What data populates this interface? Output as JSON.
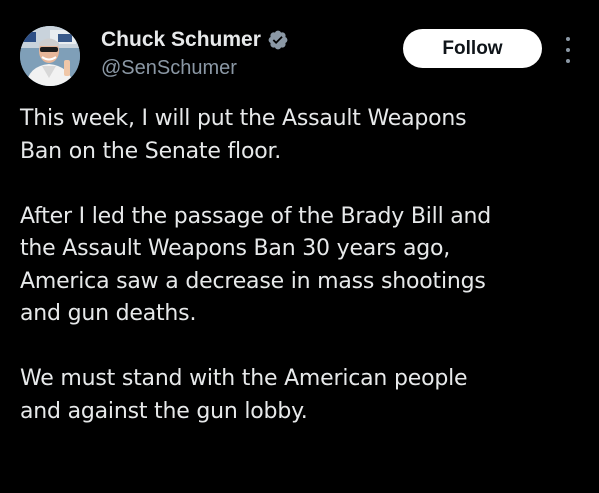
{
  "author": {
    "display_name": "Chuck Schumer",
    "handle": "@SenSchumer",
    "verified": true,
    "verified_color": "#8b98a5"
  },
  "actions": {
    "follow_label": "Follow",
    "more_icon": "more-vertical-icon"
  },
  "tweet": {
    "paragraphs": [
      {
        "lines": [
          "This week, I will put the Assault Weapons",
          "Ban on the Senate floor."
        ]
      },
      {
        "lines": [
          "After I led the passage of the Brady Bill and",
          "the Assault Weapons Ban 30 years ago,",
          "America saw a decrease in mass shootings",
          "and gun deaths."
        ]
      },
      {
        "lines": [
          "We must stand with the American people",
          "and against the gun lobby."
        ]
      }
    ]
  },
  "colors": {
    "background": "#000000",
    "text": "#e7e9ea",
    "secondary_text": "#8b98a5",
    "follow_bg": "#ffffff",
    "follow_text": "#0f1419"
  }
}
